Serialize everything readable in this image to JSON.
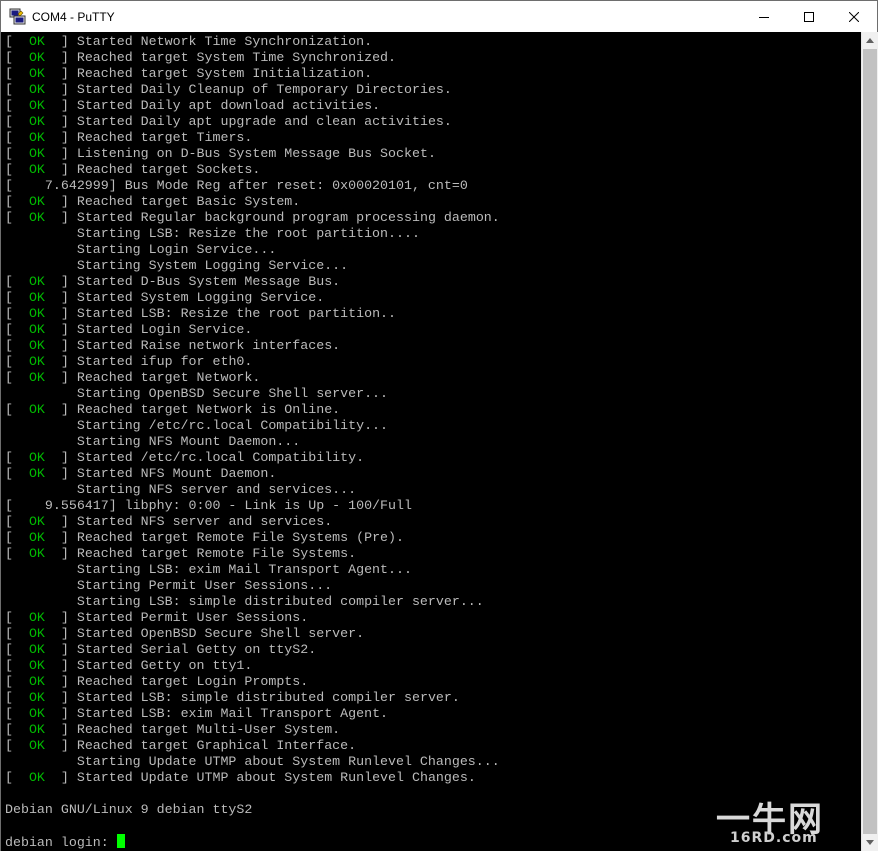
{
  "window": {
    "title": "COM4 - PuTTY",
    "app_icon": "putty-icon",
    "controls": {
      "minimize": "minimize-icon",
      "maximize": "maximize-icon",
      "close": "close-icon"
    }
  },
  "terminal": {
    "colors": {
      "background": "#000000",
      "text": "#bbbbbb",
      "ok": "#00bb00",
      "cursor": "#00ff00"
    },
    "lines": [
      {
        "status": "OK",
        "text": "Started Network Time Synchronization."
      },
      {
        "status": "OK",
        "text": "Reached target System Time Synchronized."
      },
      {
        "status": "OK",
        "text": "Reached target System Initialization."
      },
      {
        "status": "OK",
        "text": "Started Daily Cleanup of Temporary Directories."
      },
      {
        "status": "OK",
        "text": "Started Daily apt download activities."
      },
      {
        "status": "OK",
        "text": "Started Daily apt upgrade and clean activities."
      },
      {
        "status": "OK",
        "text": "Reached target Timers."
      },
      {
        "status": "OK",
        "text": "Listening on D-Bus System Message Bus Socket."
      },
      {
        "status": "OK",
        "text": "Reached target Sockets."
      },
      {
        "status": "raw",
        "text": "[    7.642999] Bus Mode Reg after reset: 0x00020101, cnt=0"
      },
      {
        "status": "OK",
        "text": "Reached target Basic System."
      },
      {
        "status": "OK",
        "text": "Started Regular background program processing daemon."
      },
      {
        "status": "indent",
        "text": "Starting LSB: Resize the root partition...."
      },
      {
        "status": "indent",
        "text": "Starting Login Service..."
      },
      {
        "status": "indent",
        "text": "Starting System Logging Service..."
      },
      {
        "status": "OK",
        "text": "Started D-Bus System Message Bus."
      },
      {
        "status": "OK",
        "text": "Started System Logging Service."
      },
      {
        "status": "OK",
        "text": "Started LSB: Resize the root partition.."
      },
      {
        "status": "OK",
        "text": "Started Login Service."
      },
      {
        "status": "OK",
        "text": "Started Raise network interfaces."
      },
      {
        "status": "OK",
        "text": "Started ifup for eth0."
      },
      {
        "status": "OK",
        "text": "Reached target Network."
      },
      {
        "status": "indent",
        "text": "Starting OpenBSD Secure Shell server..."
      },
      {
        "status": "OK",
        "text": "Reached target Network is Online."
      },
      {
        "status": "indent",
        "text": "Starting /etc/rc.local Compatibility..."
      },
      {
        "status": "indent",
        "text": "Starting NFS Mount Daemon..."
      },
      {
        "status": "OK",
        "text": "Started /etc/rc.local Compatibility."
      },
      {
        "status": "OK",
        "text": "Started NFS Mount Daemon."
      },
      {
        "status": "indent",
        "text": "Starting NFS server and services..."
      },
      {
        "status": "raw",
        "text": "[    9.556417] libphy: 0:00 - Link is Up - 100/Full"
      },
      {
        "status": "OK",
        "text": "Started NFS server and services."
      },
      {
        "status": "OK",
        "text": "Reached target Remote File Systems (Pre)."
      },
      {
        "status": "OK",
        "text": "Reached target Remote File Systems."
      },
      {
        "status": "indent",
        "text": "Starting LSB: exim Mail Transport Agent..."
      },
      {
        "status": "indent",
        "text": "Starting Permit User Sessions..."
      },
      {
        "status": "indent",
        "text": "Starting LSB: simple distributed compiler server..."
      },
      {
        "status": "OK",
        "text": "Started Permit User Sessions."
      },
      {
        "status": "OK",
        "text": "Started OpenBSD Secure Shell server."
      },
      {
        "status": "OK",
        "text": "Started Serial Getty on ttyS2."
      },
      {
        "status": "OK",
        "text": "Started Getty on tty1."
      },
      {
        "status": "OK",
        "text": "Reached target Login Prompts."
      },
      {
        "status": "OK",
        "text": "Started LSB: simple distributed compiler server."
      },
      {
        "status": "OK",
        "text": "Started LSB: exim Mail Transport Agent."
      },
      {
        "status": "OK",
        "text": "Reached target Multi-User System."
      },
      {
        "status": "OK",
        "text": "Reached target Graphical Interface."
      },
      {
        "status": "indent",
        "text": "Starting Update UTMP about System Runlevel Changes..."
      },
      {
        "status": "OK",
        "text": "Started Update UTMP about System Runlevel Changes."
      },
      {
        "status": "raw",
        "text": ""
      },
      {
        "status": "raw",
        "text": "Debian GNU/Linux 9 debian ttyS2"
      },
      {
        "status": "raw",
        "text": ""
      },
      {
        "status": "prompt",
        "text": "debian login: "
      }
    ]
  },
  "scrollbar": {
    "up": "scroll-up-arrow-icon",
    "down": "scroll-down-arrow-icon"
  },
  "watermark": {
    "text": "一牛网",
    "subtext": "16RD.com"
  }
}
